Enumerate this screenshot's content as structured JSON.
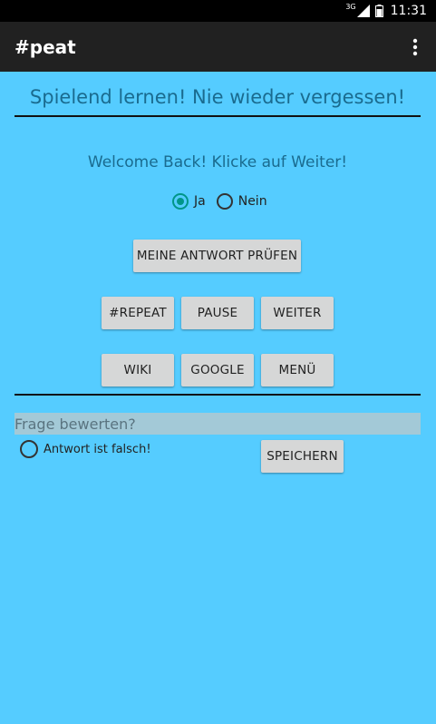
{
  "status_bar": {
    "network": "3G",
    "time": "11:31"
  },
  "app_bar": {
    "title": "#peat",
    "overflow_icon": "more-vert-icon"
  },
  "headline": "Spielend lernen! Nie wieder vergessen!",
  "welcome": "Welcome Back! Klicke auf Weiter!",
  "radio": {
    "yes_label": "Ja",
    "yes_checked": true,
    "no_label": "Nein",
    "no_checked": false
  },
  "buttons": {
    "check_answer": "MEINE ANTWORT PRÜFEN",
    "repeat": "#REPEAT",
    "pause": "PAUSE",
    "next": "WEITER",
    "wiki": "WIKI",
    "google": "GOOGLE",
    "menu": "MENÜ",
    "save": "SPEICHERN"
  },
  "rating": {
    "title": "Frage bewerten?",
    "wrong_label": "Antwort ist falsch!",
    "wrong_checked": false
  },
  "colors": {
    "background": "#55ccff",
    "app_bar": "#212121",
    "accent": "#009688",
    "button": "#d6d7d7"
  }
}
